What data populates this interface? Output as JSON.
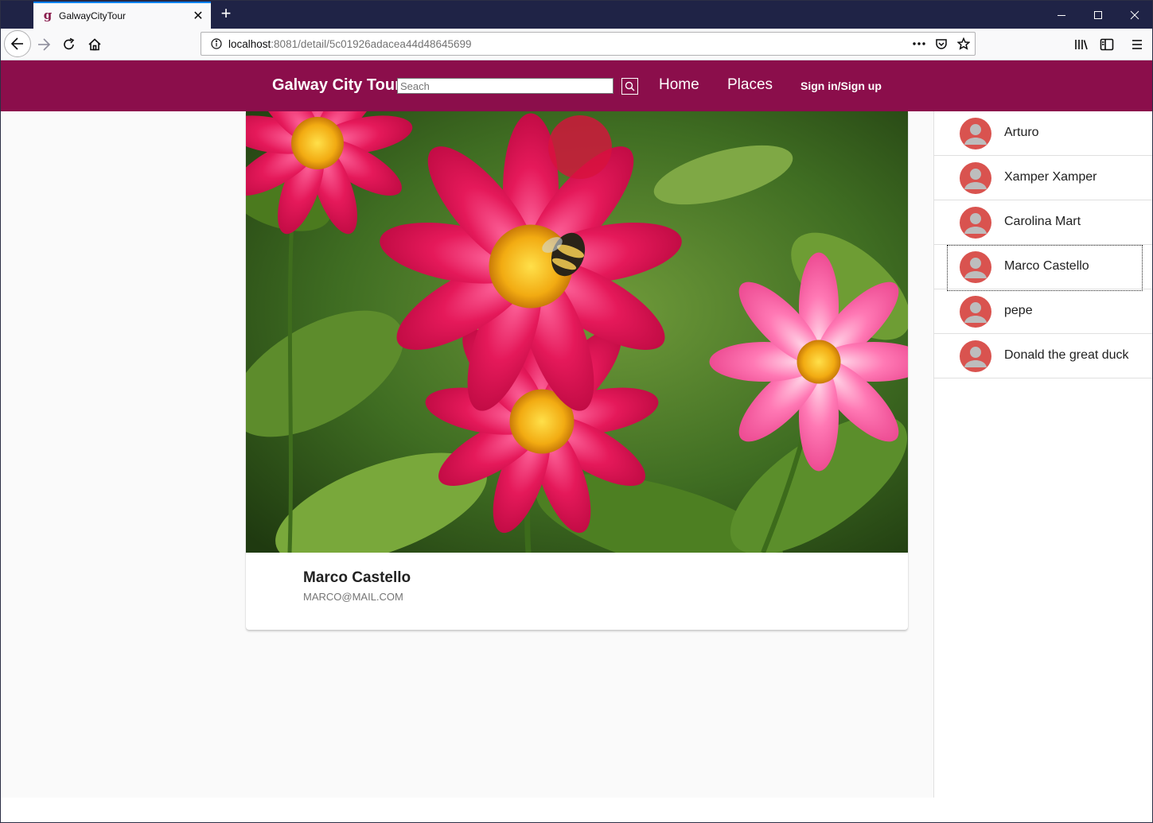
{
  "browser": {
    "tab_title": "GalwayCityTour",
    "tab_favicon": "g",
    "url_host": "localhost",
    "url_path": ":8081/detail/5c01926adacea44d48645699"
  },
  "navbar": {
    "brand": "Galway City Tour",
    "search_placeholder": "Seach",
    "home_label": "Home",
    "places_label": "Places",
    "sign_label": "Sign in/Sign up",
    "color": "#8b0e4b"
  },
  "detail": {
    "name": "Marco Castello",
    "email": "MARCO@MAIL.COM"
  },
  "users": [
    {
      "name": "Arturo"
    },
    {
      "name": "Xamper Xamper"
    },
    {
      "name": "Carolina Mart"
    },
    {
      "name": "Marco Castello",
      "selected": true
    },
    {
      "name": "pepe"
    },
    {
      "name": "Donald the great duck"
    }
  ],
  "colors": {
    "avatar": "#d9534f",
    "accent_tab": "#0a84ff"
  }
}
